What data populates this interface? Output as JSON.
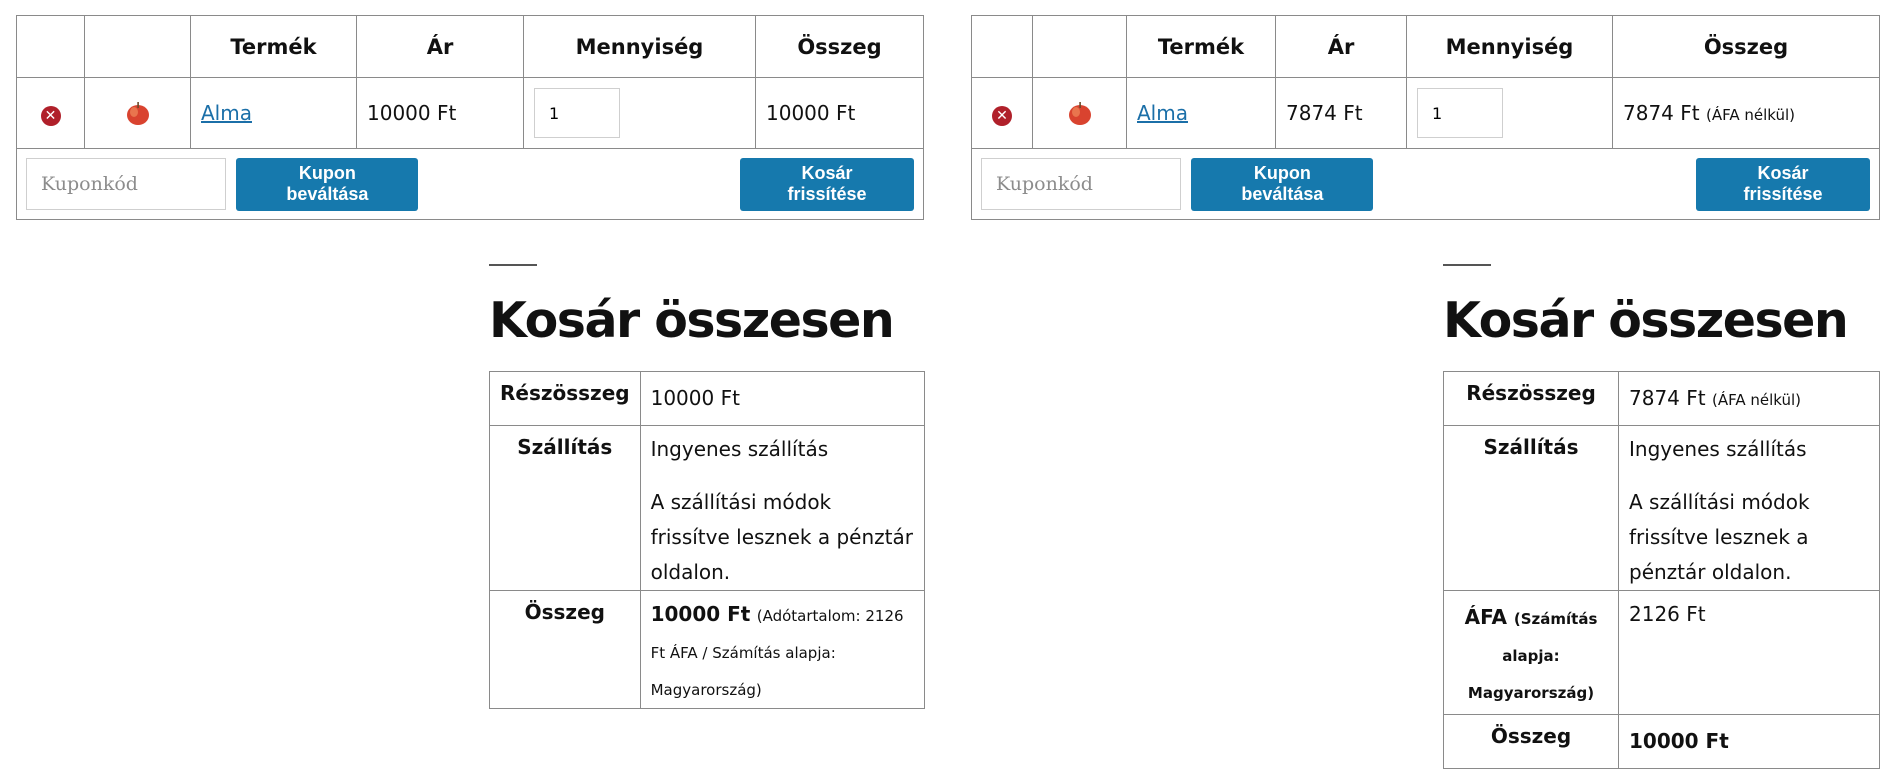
{
  "columns": [
    "",
    "",
    "Termék",
    "Ár",
    "Mennyiség",
    "Összeg"
  ],
  "left": {
    "item": {
      "name": "Alma",
      "price": "10000 Ft",
      "qty": "1",
      "total": "10000 Ft",
      "total_note": ""
    },
    "coupon_placeholder": "Kuponkód",
    "apply_label": "Kupon beváltása",
    "update_label": "Kosár frissítése",
    "totals_title": "Kosár összesen",
    "subtotal_label": "Részösszeg",
    "subtotal_value": "10000 Ft",
    "subtotal_note": "",
    "shipping_label": "Szállítás",
    "shipping_value": "Ingyenes szállítás",
    "shipping_note": "A szállítási módok frissítve lesznek a pénztár oldalon.",
    "total_label": "Összeg",
    "total_value": "10000 Ft",
    "total_tax_note": "(Adótartalom: 2126 Ft ÁFA / Számítás alapja: Magyarország)"
  },
  "right": {
    "item": {
      "name": "Alma",
      "price": "7874 Ft",
      "qty": "1",
      "total": "7874 Ft",
      "total_note": "(ÁFA nélkül)"
    },
    "coupon_placeholder": "Kuponkód",
    "apply_label": "Kupon beváltása",
    "update_label": "Kosár frissítése",
    "totals_title": "Kosár összesen",
    "subtotal_label": "Részösszeg",
    "subtotal_value": "7874 Ft",
    "subtotal_note": "(ÁFA nélkül)",
    "shipping_label": "Szállítás",
    "shipping_value": "Ingyenes szállítás",
    "shipping_note": "A szállítási módok frissítve lesznek a pénztár oldalon.",
    "tax_label": "ÁFA",
    "tax_label_note": "(Számítás alapja: Magyarország)",
    "tax_value": "2126 Ft",
    "total_label": "Összeg",
    "total_value": "10000 Ft"
  },
  "colors": {
    "remove": "#b0202a",
    "button": "#1679ad",
    "link": "#1b6fa8"
  },
  "icons": {
    "remove": "remove-x-icon",
    "product": "apple-icon"
  }
}
